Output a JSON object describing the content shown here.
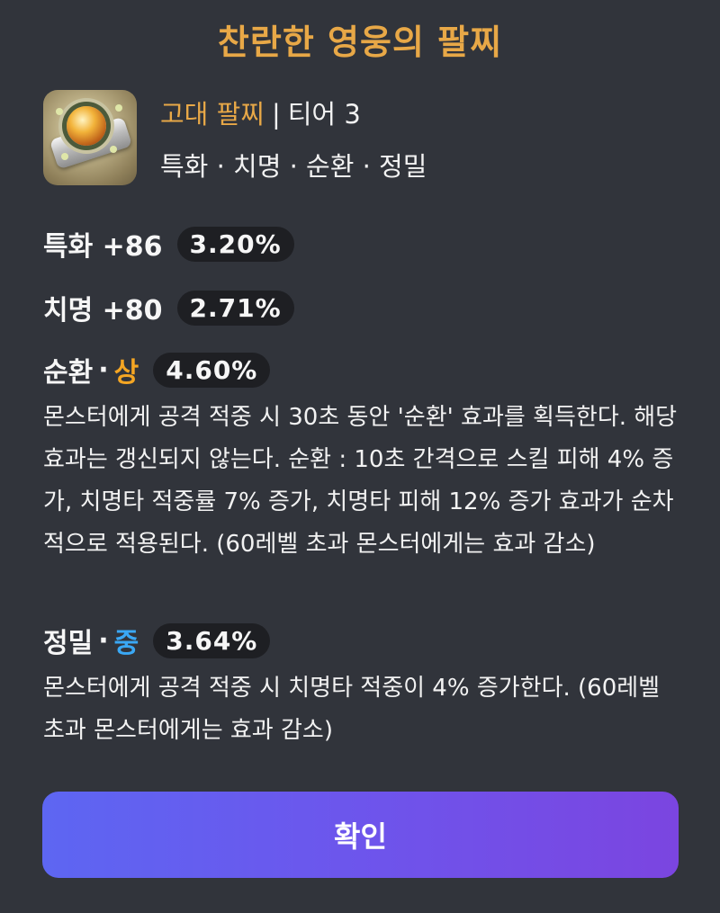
{
  "dialog": {
    "title": "찬란한 영웅의 팔찌",
    "confirm_label": "확인"
  },
  "item": {
    "icon": "bracelet-icon",
    "name": "고대 팔찌",
    "separator": "|",
    "tier": "티어 3",
    "stats_summary": "특화 · 치명 · 순환 · 정밀"
  },
  "stats": [
    {
      "label": "특화 +86",
      "percent": "3.20%"
    },
    {
      "label": "치명 +80",
      "percent": "2.71%"
    }
  ],
  "effects": [
    {
      "name": "순환",
      "dot": "·",
      "grade": "상",
      "grade_color": "#f5a623",
      "percent": "4.60%",
      "description": "몬스터에게 공격 적중 시 30초 동안 '순환' 효과를 획득한다. 해당 효과는 갱신되지 않는다. 순환 : 10초 간격으로 스킬 피해 4% 증가, 치명타 적중률 7% 증가, 치명타 피해 12% 증가 효과가 순차적으로 적용된다. (60레벨 초과 몬스터에게는 효과 감소)"
    },
    {
      "name": "정밀",
      "dot": "·",
      "grade": "중",
      "grade_color": "#3aa8f5",
      "percent": "3.64%",
      "description": "몬스터에게 공격 적중 시 치명타 적중이 4% 증가한다. (60레벨 초과 몬스터에게는 효과 감소)"
    }
  ],
  "colors": {
    "background": "#31343b",
    "title": "#e8a847",
    "badge_bg": "#1e1f23",
    "button_gradient_start": "#5d66f2",
    "button_gradient_end": "#7b45e0"
  }
}
